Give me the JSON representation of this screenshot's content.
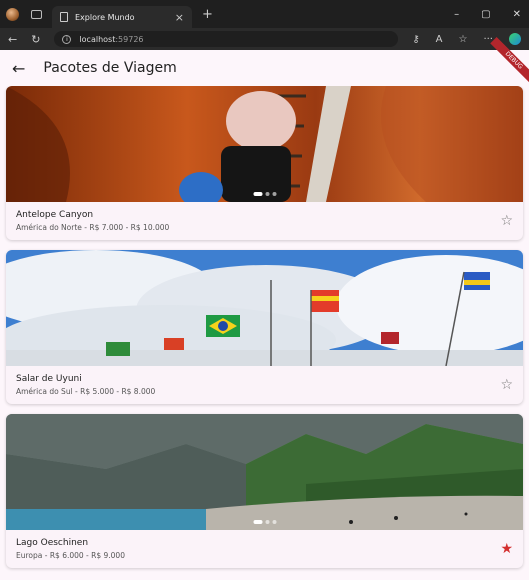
{
  "browser": {
    "tab_title": "Explore Mundo",
    "url_host": "localhost",
    "url_port": ":59726"
  },
  "app": {
    "title": "Pacotes de Viagem",
    "debug_label": "DEBUG"
  },
  "packages": [
    {
      "name": "Antelope Canyon",
      "details": "América do Norte - R$ 7.000 - R$ 10.000",
      "favorite": false,
      "carousel": {
        "count": 3,
        "active": 0
      }
    },
    {
      "name": "Salar de Uyuni",
      "details": "América do Sul - R$ 5.000 - R$ 8.000",
      "favorite": false,
      "carousel": null
    },
    {
      "name": "Lago Oeschinen",
      "details": "Europa - R$ 6.000 - R$ 9.000",
      "favorite": true,
      "carousel": {
        "count": 3,
        "active": 0
      }
    }
  ],
  "icons": {
    "back": "arrow-left-icon",
    "star_empty": "star-outline-icon",
    "star_filled": "star-filled-icon"
  },
  "colors": {
    "favorite": "#d32f2f",
    "background": "#fdf6fb"
  }
}
